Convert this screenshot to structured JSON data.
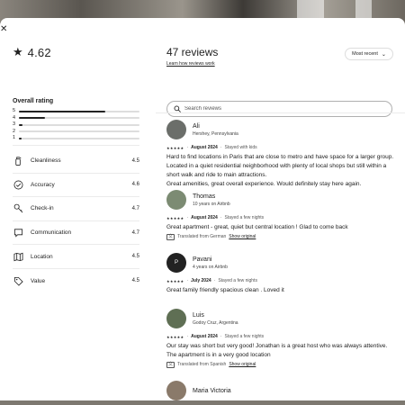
{
  "rating": {
    "average": "4.62"
  },
  "overall": {
    "title": "Overall rating",
    "distribution": [
      {
        "stars": "5",
        "fraction": 0.72
      },
      {
        "stars": "4",
        "fraction": 0.22
      },
      {
        "stars": "3",
        "fraction": 0.03
      },
      {
        "stars": "2",
        "fraction": 0.0
      },
      {
        "stars": "1",
        "fraction": 0.02
      }
    ]
  },
  "categories": [
    {
      "label": "Cleanliness",
      "score": "4.5",
      "icon": "spray-bottle-icon"
    },
    {
      "label": "Accuracy",
      "score": "4.6",
      "icon": "check-circle-icon"
    },
    {
      "label": "Check-in",
      "score": "4.7",
      "icon": "key-icon"
    },
    {
      "label": "Communication",
      "score": "4.7",
      "icon": "message-bubble-icon"
    },
    {
      "label": "Location",
      "score": "4.5",
      "icon": "map-icon"
    },
    {
      "label": "Value",
      "score": "4.5",
      "icon": "tag-icon"
    }
  ],
  "header": {
    "title": "47 reviews",
    "learn_link": "Learn how reviews work",
    "sort_label": "Most recent"
  },
  "search": {
    "placeholder": "Search reviews"
  },
  "reviews": [
    {
      "name": "Ali",
      "subtitle": "Hershey, Pennsylvania",
      "date": "August 2024",
      "stay": "Stayed with kids",
      "text": "Hard to find locations in Paris that are close to metro and have space for a larger group. Located in a quiet residential neighborhood with plenty of local shops but still within a short walk and ride to main attractions.\nGreat amenities, great overall experience. Would definitely stay here again."
    },
    {
      "name": "Thomas",
      "subtitle": "10 years on Airbnb",
      "date": "August 2024",
      "stay": "Stayed a few nights",
      "text": "Great apartment - great, quiet but central location ! Glad to come back",
      "translated": "Translated from German",
      "show_original": "Show original"
    },
    {
      "name": "Pavani",
      "initial": "P",
      "subtitle": "4 years on Airbnb",
      "date": "July 2024",
      "stay": "Stayed a few nights",
      "text": "Great family friendly spacious clean . Loved it"
    },
    {
      "name": "Luis",
      "subtitle": "Godoy Cruz, Argentina",
      "date": "August 2024",
      "stay": "Stayed a few nights",
      "text": "Our stay was short but very good! Jonathan is a great host who was always attentive. The apartment is in a very good location",
      "translated": "Translated from Spanish",
      "show_original": "Show original"
    },
    {
      "name": "Maria Victoria"
    }
  ],
  "colors": {
    "accent": "#222222",
    "divider": "#ebebeb",
    "track": "#dddddd"
  }
}
